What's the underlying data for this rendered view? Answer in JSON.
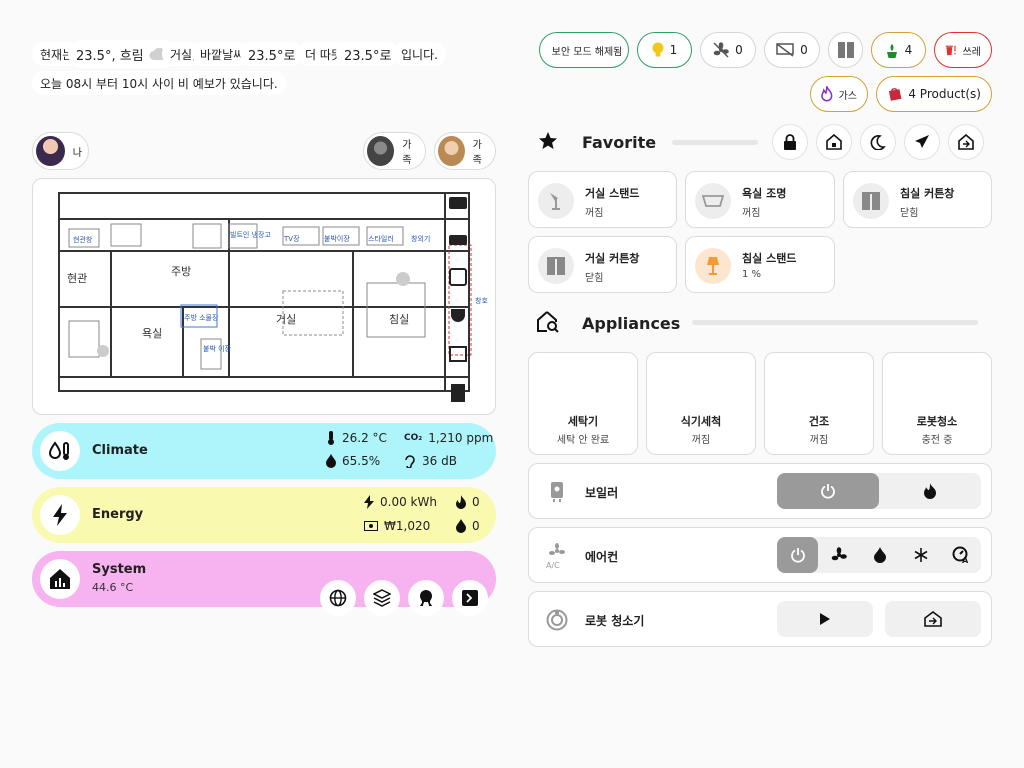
{
  "header": {
    "weather_segments": [
      "현재는",
      "23.5°, 흐림",
      "거실,",
      "바깥날씨",
      "23.5°로",
      "더 따뜻",
      "23.5°로",
      "입니다."
    ],
    "forecast": "오늘 08시 부터 10시 사이 비 예보가 있습니다."
  },
  "chips": {
    "security": "보안 모드 해제됨",
    "lights_count": "1",
    "fans_count": "0",
    "screens_count": "0",
    "plants_count": "4",
    "trash_label": "쓰레",
    "gas_label": "가스",
    "products_label": "4 Product(s)"
  },
  "people": {
    "person1": "나",
    "person2": "가족",
    "person3": "가족"
  },
  "favorite": {
    "title": "Favorite",
    "tiles": [
      {
        "name": "거실 스탠드",
        "state": "꺼짐"
      },
      {
        "name": "욕실 조명",
        "state": "꺼짐"
      },
      {
        "name": "침실 커튼창",
        "state": "닫힘"
      },
      {
        "name": "거실 커튼창",
        "state": "닫힘"
      },
      {
        "name": "침실 스탠드",
        "state": "1 %"
      }
    ]
  },
  "appliances": {
    "title": "Appliances",
    "items": [
      {
        "name": "세탁기",
        "state": "세탁 안 완료"
      },
      {
        "name": "식기세척",
        "state": "꺼짐"
      },
      {
        "name": "건조",
        "state": "꺼짐"
      },
      {
        "name": "로봇청소",
        "state": "충전 중"
      }
    ]
  },
  "controls": {
    "heater": "보일러",
    "aircon": "에어컨",
    "robot": "로봇 청소기"
  },
  "status": {
    "climate": {
      "title": "Climate",
      "temperature": "26.2 °C",
      "co2": "1,210 ppm",
      "humidity": "65.5%",
      "noise": "36 dB"
    },
    "energy": {
      "title": "Energy",
      "power": "0.00 kWh",
      "gas": "0",
      "cost": "₩1,020",
      "water": "0"
    },
    "system": {
      "title": "System",
      "temperature": "44.6 °C"
    }
  },
  "floorplan": {
    "rooms": [
      "현관창",
      "빌트인 냉장고",
      "TV장",
      "붙박이장",
      "스타일러",
      "창외기",
      "현관",
      "주방",
      "거실",
      "침실",
      "욕실",
      "주방 소물장",
      "붙박 이장",
      "창호"
    ]
  },
  "colors": {
    "climate_bg": "#aef5fb",
    "energy_bg": "#faf9b0",
    "system_bg": "#f7b2f0",
    "security_green": "#2e9f62",
    "light_yellow": "#f2c71b",
    "trash_red": "#e0322e",
    "plant_green": "#1e8a2d",
    "gas_purple": "#8b2fc9",
    "product_red": "#c6293f"
  }
}
